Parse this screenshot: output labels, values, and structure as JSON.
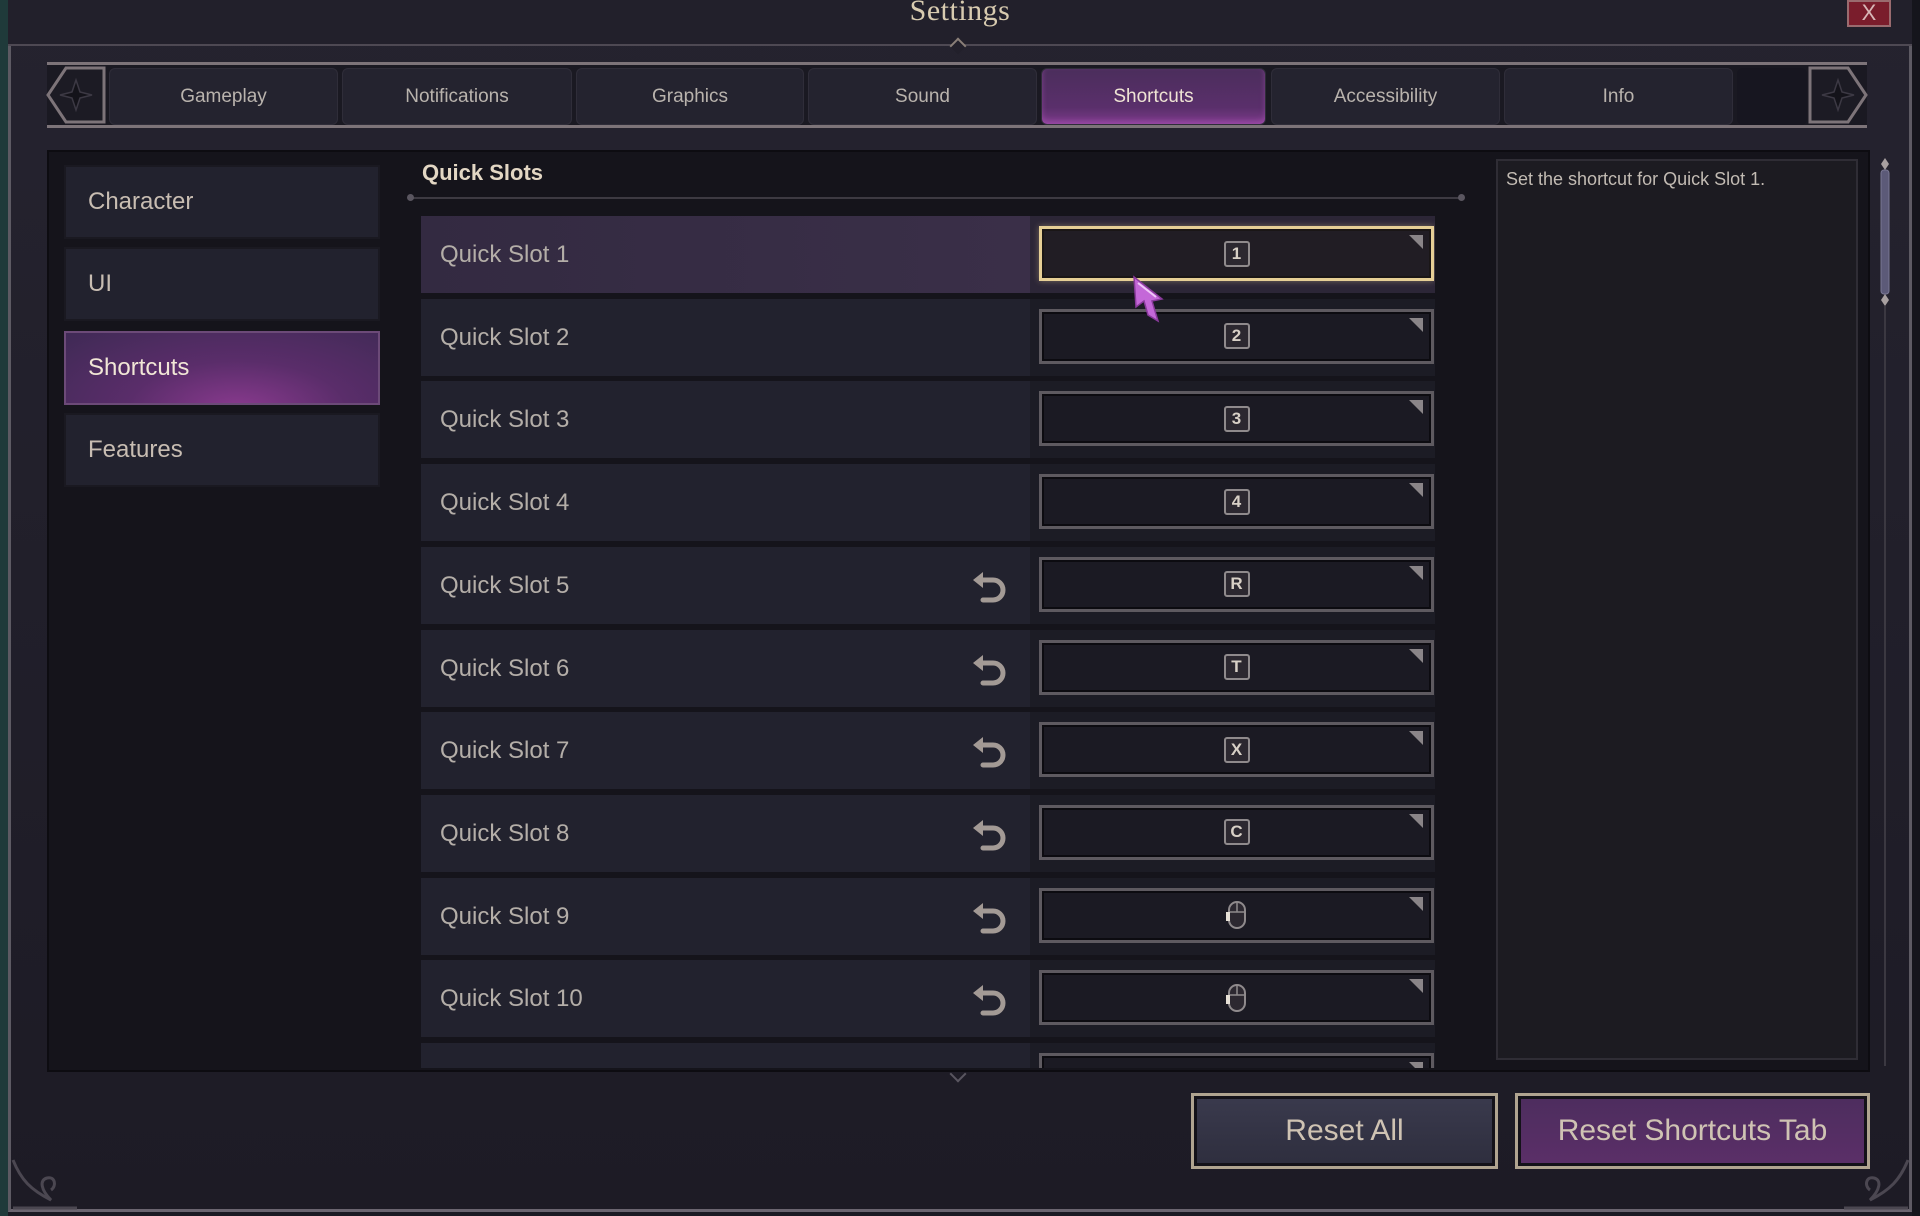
{
  "window": {
    "title": "Settings",
    "close_label": "X"
  },
  "tabs": [
    {
      "label": "Gameplay",
      "active": false
    },
    {
      "label": "Notifications",
      "active": false
    },
    {
      "label": "Graphics",
      "active": false
    },
    {
      "label": "Sound",
      "active": false
    },
    {
      "label": "Shortcuts",
      "active": true
    },
    {
      "label": "Accessibility",
      "active": false
    },
    {
      "label": "Info",
      "active": false
    }
  ],
  "sidebar": {
    "items": [
      {
        "label": "Character",
        "active": false
      },
      {
        "label": "UI",
        "active": false
      },
      {
        "label": "Shortcuts",
        "active": true
      },
      {
        "label": "Features",
        "active": false
      }
    ]
  },
  "section": {
    "title": "Quick Slots",
    "rows": [
      {
        "label": "Quick Slot 1",
        "key": "1",
        "key_type": "keyboard",
        "resettable": false,
        "selected": true
      },
      {
        "label": "Quick Slot 2",
        "key": "2",
        "key_type": "keyboard",
        "resettable": false,
        "selected": false
      },
      {
        "label": "Quick Slot 3",
        "key": "3",
        "key_type": "keyboard",
        "resettable": false,
        "selected": false
      },
      {
        "label": "Quick Slot 4",
        "key": "4",
        "key_type": "keyboard",
        "resettable": false,
        "selected": false
      },
      {
        "label": "Quick Slot 5",
        "key": "R",
        "key_type": "keyboard",
        "resettable": true,
        "selected": false
      },
      {
        "label": "Quick Slot 6",
        "key": "T",
        "key_type": "keyboard",
        "resettable": true,
        "selected": false
      },
      {
        "label": "Quick Slot 7",
        "key": "X",
        "key_type": "keyboard",
        "resettable": true,
        "selected": false
      },
      {
        "label": "Quick Slot 8",
        "key": "C",
        "key_type": "keyboard",
        "resettable": true,
        "selected": false
      },
      {
        "label": "Quick Slot 9",
        "key": "mouse-side-button",
        "key_type": "mouse",
        "resettable": true,
        "selected": false
      },
      {
        "label": "Quick Slot 10",
        "key": "mouse-side-button",
        "key_type": "mouse",
        "resettable": true,
        "selected": false
      },
      {
        "label": "",
        "key": "",
        "key_type": "keyboard",
        "resettable": true,
        "selected": false
      }
    ]
  },
  "description": {
    "text": "Set the shortcut for Quick Slot 1."
  },
  "buttons": {
    "reset_all": "Reset All",
    "reset_tab": "Reset Shortcuts Tab"
  },
  "colors": {
    "accent_purple": "#5a2f6b",
    "selected_border": "#e6cf96",
    "close_red": "#7a1d2c"
  }
}
